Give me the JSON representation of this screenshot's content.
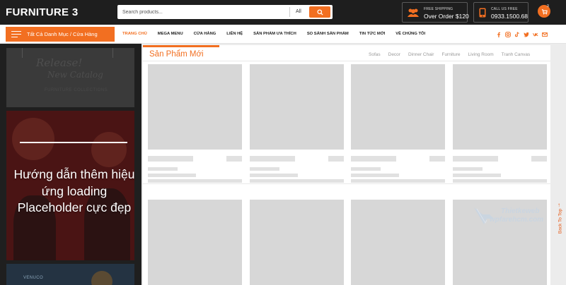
{
  "header": {
    "logo": "FURNITURE 3",
    "search_placeholder": "Search products...",
    "search_category": "All",
    "shipping_small": "FREE SHIPPING",
    "shipping_big": "Over Order $120",
    "call_small": "CALL US FREE",
    "call_big": "0933.1500.68",
    "cart_count": "3"
  },
  "nav": {
    "category_button": "Tất Cả Danh Mục / Cửa Hàng",
    "menu": [
      "TRANG CHỦ",
      "MEGA MENU",
      "CỬA HÀNG",
      "LIÊN HỆ",
      "SẢN PHẨM ƯA THÍCH",
      "SO SÁNH SẢN PHẨM",
      "TIN TỨC MỚI",
      "VỀ CHÚNG TÔI"
    ],
    "active_index": 0,
    "social_icons": [
      "facebook-icon",
      "instagram-icon",
      "tiktok-icon",
      "twitter-icon",
      "vk-icon",
      "mail-icon"
    ]
  },
  "sidebar": {
    "banner_top_line1": "Release!",
    "banner_top_line2": "New Catalog",
    "banner_top_line3": "FURNITURE COLLECTIONS",
    "banner_overlay_text": "Hướng dẫn thêm hiệu ứng  loading Placeholder cực đẹp",
    "banner_bottom_label": "VENUCO"
  },
  "main": {
    "section_title": "Sản Phẩm Mới",
    "tabs": [
      "Sofas",
      "Decor",
      "Dinner Chair",
      "Furniture",
      "Living Room",
      "Tranh Canvas"
    ]
  },
  "watermark": {
    "line1": "Thietkeweb",
    "line2": "wpfarehcm.com"
  },
  "back_to_top": "Back To Top",
  "colors": {
    "accent": "#f26f21",
    "header_bg": "#1e1e1e",
    "placeholder": "#d7d7d7"
  }
}
